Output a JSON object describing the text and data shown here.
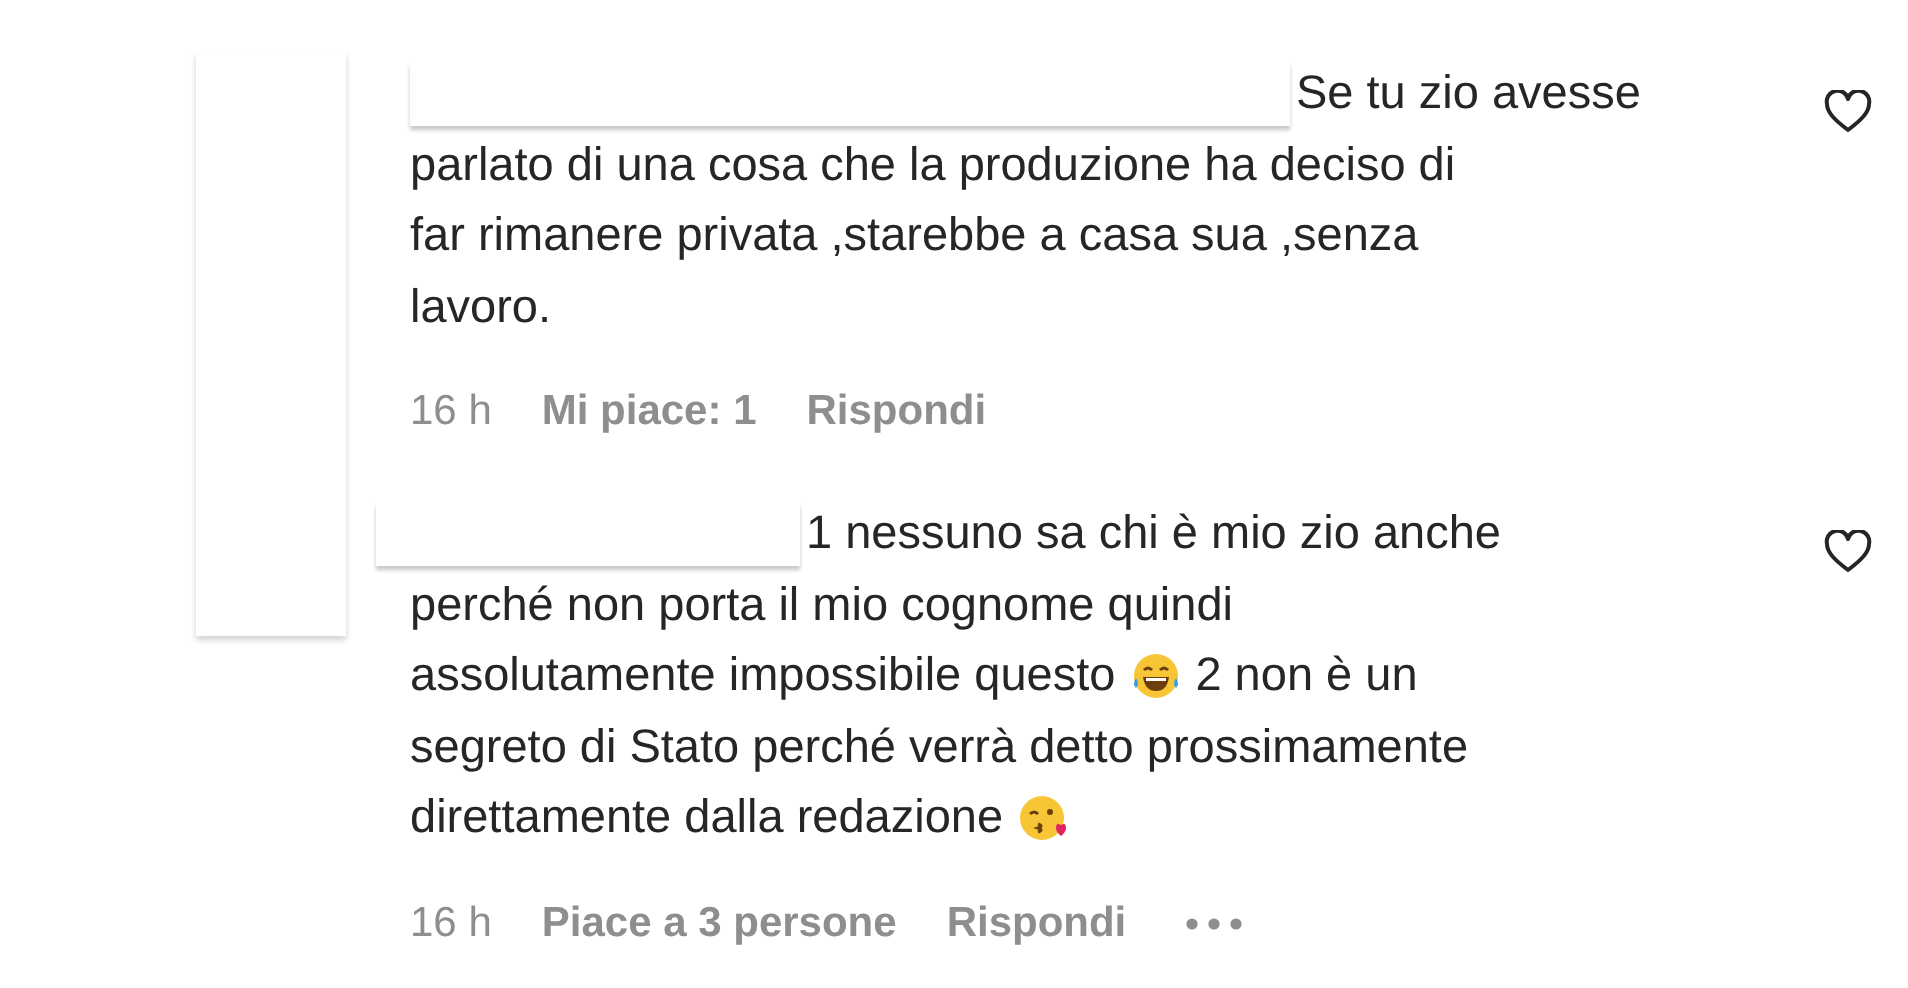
{
  "comments": [
    {
      "lines": [
        [
          {
            "kind": "redacted"
          },
          {
            "kind": "text",
            "text": "Se tu zio avesse"
          }
        ],
        [
          {
            "kind": "text",
            "text": "parlato di una cosa che la produzione ha deciso di"
          }
        ],
        [
          {
            "kind": "text",
            "text": "far rimanere privata ,starebbe a casa sua ,senza"
          }
        ],
        [
          {
            "kind": "text",
            "text": "lavoro."
          }
        ]
      ],
      "time": "16 h",
      "likes": "Mi piace: 1",
      "reply": "Rispondi",
      "liked": false,
      "show_more": false
    },
    {
      "lines": [
        [
          {
            "kind": "redacted"
          },
          {
            "kind": "text",
            "text": "1 nessuno sa chi è mio zio anche"
          }
        ],
        [
          {
            "kind": "text",
            "text": "perché non porta il mio cognome quindi"
          }
        ],
        [
          {
            "kind": "text",
            "text": "assolutamente impossibile questo"
          },
          {
            "kind": "laugh_emoji"
          },
          {
            "kind": "text",
            "text": "2 non è un"
          }
        ],
        [
          {
            "kind": "text",
            "text": "segreto di Stato perché verrà detto prossimamente"
          }
        ],
        [
          {
            "kind": "text",
            "text": "direttamente dalla redazione"
          },
          {
            "kind": "kiss_emoji"
          }
        ]
      ],
      "time": "16 h",
      "likes": "Piace a 3 persone",
      "reply": "Rispondi",
      "liked": false,
      "show_more": true
    }
  ]
}
